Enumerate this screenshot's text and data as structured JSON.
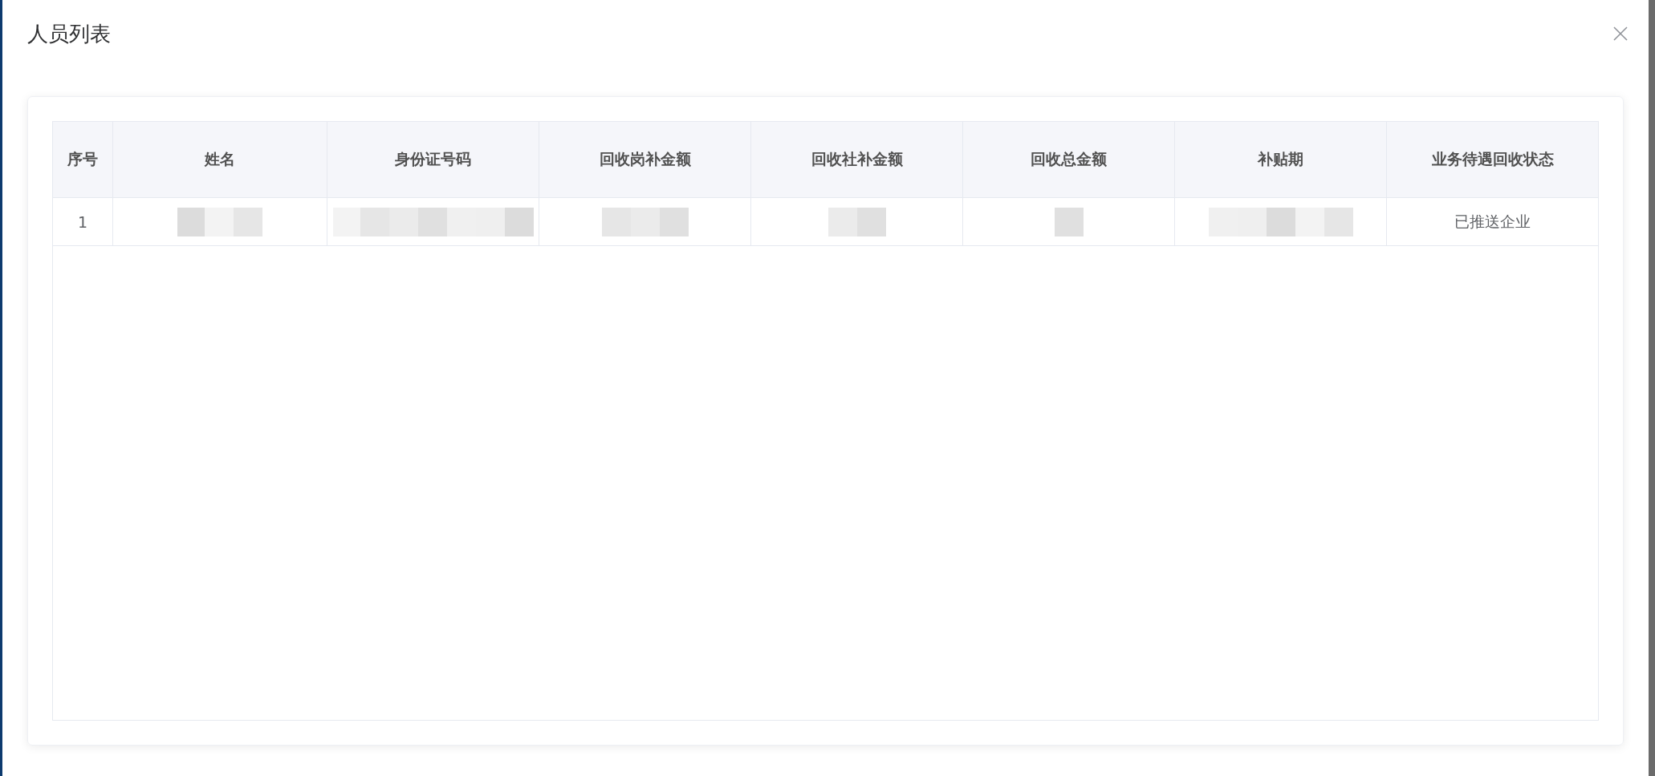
{
  "dialog": {
    "title": "人员列表",
    "closable": true
  },
  "table": {
    "columns": [
      "序号",
      "姓名",
      "身份证号码",
      "回收岗补金额",
      "回收社补金额",
      "回收总金额",
      "补贴期",
      "业务待遇回收状态"
    ],
    "rows": [
      {
        "cells": [
          {
            "kind": "text",
            "text": "1"
          },
          {
            "kind": "redacted"
          },
          {
            "kind": "redacted"
          },
          {
            "kind": "redacted"
          },
          {
            "kind": "redacted"
          },
          {
            "kind": "redacted"
          },
          {
            "kind": "redacted"
          },
          {
            "kind": "text",
            "text": "已推送企业"
          }
        ]
      }
    ]
  }
}
